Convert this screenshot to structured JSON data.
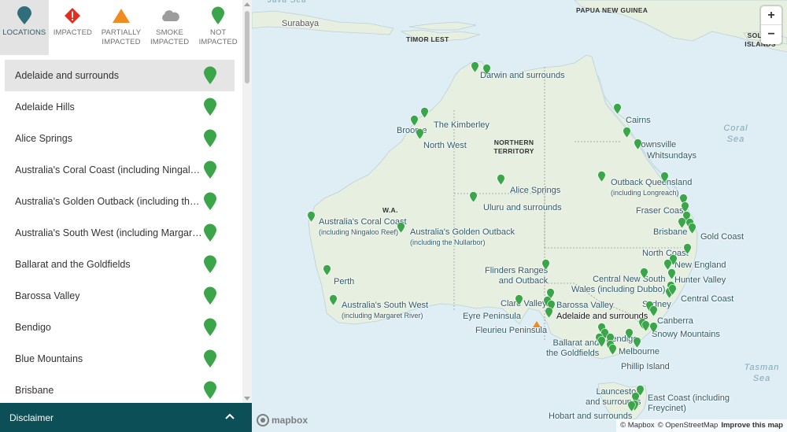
{
  "filters": [
    {
      "label": "LOCATIONS",
      "icon": "location-pin-icon",
      "active": true
    },
    {
      "label": "IMPACTED",
      "icon": "warning-diamond-icon"
    },
    {
      "label": "PARTIALLY IMPACTED",
      "icon": "warning-triangle-icon"
    },
    {
      "label": "SMOKE IMPACTED",
      "icon": "cloud-icon"
    },
    {
      "label": "NOT IMPACTED",
      "icon": "green-pin-icon"
    }
  ],
  "locations": [
    {
      "label": "Adelaide and surrounds",
      "status": "not-impacted",
      "selected": true
    },
    {
      "label": "Adelaide Hills",
      "status": "not-impacted"
    },
    {
      "label": "Alice Springs",
      "status": "not-impacted"
    },
    {
      "label": "Australia's Coral Coast (including Ningaloo Reef)",
      "status": "not-impacted"
    },
    {
      "label": "Australia's Golden Outback (including the Nullarbor)",
      "status": "not-impacted"
    },
    {
      "label": "Australia's South West (including Margaret River)",
      "status": "not-impacted"
    },
    {
      "label": "Ballarat and the Goldfields",
      "status": "not-impacted"
    },
    {
      "label": "Barossa Valley",
      "status": "not-impacted"
    },
    {
      "label": "Bendigo",
      "status": "not-impacted"
    },
    {
      "label": "Blue Mountains",
      "status": "not-impacted"
    },
    {
      "label": "Brisbane",
      "status": "not-impacted"
    }
  ],
  "disclaimer": {
    "label": "Disclaimer"
  },
  "colors": {
    "teal": "#0d4f56",
    "pin_green": "#3aa649",
    "land": "#e6efe0",
    "water": "#dfeef5",
    "impacted_red": "#e42c1f",
    "partial_orange": "#f08c1e"
  },
  "map": {
    "place_labels": [
      {
        "text": "Darwin and surrounds"
      },
      {
        "text": "The Kimberley"
      },
      {
        "text": "Broome"
      },
      {
        "text": "North West"
      },
      {
        "text": "Cairns"
      },
      {
        "text": "Townsville"
      },
      {
        "text": "Whitsundays"
      },
      {
        "text": "Outback Queensland",
        "sub": "(including Longreach)"
      },
      {
        "text": "Alice Springs"
      },
      {
        "text": "Uluru and surrounds"
      },
      {
        "text": "Fraser Coast"
      },
      {
        "text": "Australia's Coral Coast",
        "sub": "(including Ningaloo Reef)"
      },
      {
        "text": "Australia's Golden Outback",
        "sub": "(including the Nullarbor)"
      },
      {
        "text": "Brisbane"
      },
      {
        "text": "Gold Coast"
      },
      {
        "text": "North Coast"
      },
      {
        "text": "New England"
      },
      {
        "text": "Flinders Ranges",
        "sub2": "and Outback"
      },
      {
        "text": "Perth"
      },
      {
        "text": "Central New South",
        "sub2": "Wales (including Dubbo)"
      },
      {
        "text": "Hunter Valley"
      },
      {
        "text": "Central Coast"
      },
      {
        "text": "Sydney"
      },
      {
        "text": "Clare Valley"
      },
      {
        "text": "Barossa Valley"
      },
      {
        "text": "Australia's South West",
        "sub": "(including Margaret River)"
      },
      {
        "text": "Eyre Peninsula"
      },
      {
        "text": "Adelaide and surrounds"
      },
      {
        "text": "Canberra"
      },
      {
        "text": "Fleurieu Peninsula"
      },
      {
        "text": "Snowy Mountains"
      },
      {
        "text": "Ballarat and",
        "sub2": "the Goldfields"
      },
      {
        "text": "Bendigo"
      },
      {
        "text": "Melbourne"
      },
      {
        "text": "Phillip Island"
      },
      {
        "text": "Launceston",
        "sub2": "and surrounds"
      },
      {
        "text": "East Coast (including",
        "sub2": "Freycinet)"
      },
      {
        "text": "Hobart and surrounds"
      }
    ],
    "regions": [
      {
        "text": "PAPUA NEW GUINEA"
      },
      {
        "text": "TIMOR LEST"
      },
      {
        "text": "NORTHERN TERRITORY"
      },
      {
        "text": "W.A."
      },
      {
        "text": "SOLOM ISLANDS"
      }
    ],
    "cities": [
      {
        "text": "Surabaya"
      },
      {
        "text": "Java Sea"
      }
    ],
    "seas": [
      {
        "text": "Coral Sea"
      },
      {
        "text": "Tasman Sea"
      }
    ],
    "zoom_in": "+",
    "zoom_out": "−",
    "mapbox_logo": "mapbox",
    "attribution": {
      "mapbox": "© Mapbox",
      "osm": "© OpenStreetMap",
      "improve": "Improve this map"
    }
  }
}
